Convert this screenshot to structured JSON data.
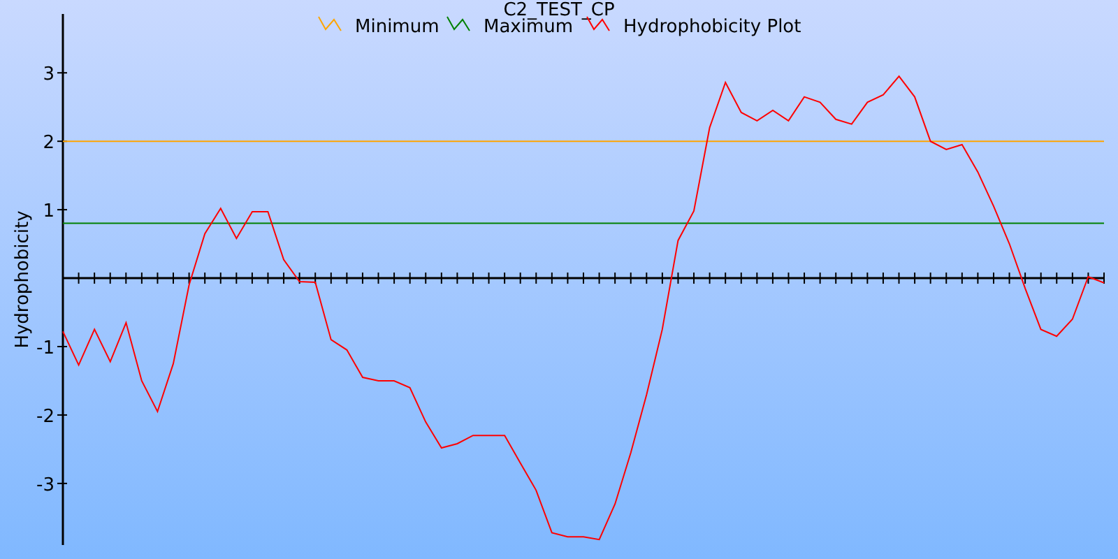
{
  "chart_data": {
    "type": "line",
    "title": "C2_TEST_CP",
    "ylabel": "Hydrophobicity",
    "legend": "top",
    "series": [
      {
        "name": "Minimum",
        "color": "#ffa500",
        "values": [
          2,
          2,
          2,
          2,
          2,
          2,
          2,
          2,
          2,
          2,
          2,
          2,
          2,
          2,
          2,
          2,
          2,
          2,
          2,
          2,
          2,
          2,
          2,
          2,
          2,
          2,
          2,
          2,
          2,
          2,
          2,
          2,
          2,
          2,
          2,
          2,
          2,
          2,
          2,
          2,
          2,
          2,
          2,
          2,
          2,
          2,
          2,
          2,
          2,
          2,
          2,
          2,
          2,
          2,
          2,
          2,
          2,
          2,
          2,
          2,
          2,
          2,
          2,
          2,
          2,
          2,
          2
        ]
      },
      {
        "name": "Maximum",
        "color": "#008000",
        "values": [
          0.8,
          0.8,
          0.8,
          0.8,
          0.8,
          0.8,
          0.8,
          0.8,
          0.8,
          0.8,
          0.8,
          0.8,
          0.8,
          0.8,
          0.8,
          0.8,
          0.8,
          0.8,
          0.8,
          0.8,
          0.8,
          0.8,
          0.8,
          0.8,
          0.8,
          0.8,
          0.8,
          0.8,
          0.8,
          0.8,
          0.8,
          0.8,
          0.8,
          0.8,
          0.8,
          0.8,
          0.8,
          0.8,
          0.8,
          0.8,
          0.8,
          0.8,
          0.8,
          0.8,
          0.8,
          0.8,
          0.8,
          0.8,
          0.8,
          0.8,
          0.8,
          0.8,
          0.8,
          0.8,
          0.8,
          0.8,
          0.8,
          0.8,
          0.8,
          0.8,
          0.8,
          0.8,
          0.8,
          0.8,
          0.8,
          0.8,
          0.8
        ]
      },
      {
        "name": "Hydrophobicity Plot",
        "color": "#ff0000",
        "values": [
          -0.78,
          -1.27,
          -0.75,
          -1.22,
          -0.65,
          -1.5,
          -1.95,
          -1.25,
          -0.1,
          0.65,
          1.02,
          0.58,
          0.97,
          0.97,
          0.27,
          -0.05,
          -0.06,
          -0.9,
          -1.05,
          -1.45,
          -1.5,
          -1.5,
          -1.6,
          -2.1,
          -2.48,
          -2.42,
          -2.3,
          -2.3,
          -2.3,
          -2.7,
          -3.1,
          -3.72,
          -3.78,
          -3.78,
          -3.82,
          -3.3,
          -2.55,
          -1.7,
          -0.75,
          0.55,
          0.98,
          2.2,
          2.86,
          2.42,
          2.3,
          2.45,
          2.3,
          2.65,
          2.57,
          2.32,
          2.25,
          2.57,
          2.68,
          2.95,
          2.65,
          2.0,
          1.88,
          1.95,
          1.55,
          1.05,
          0.5,
          -0.15,
          -0.75,
          -0.85,
          -0.6,
          0.02,
          -0.07
        ]
      }
    ],
    "ylim": [
      -3.9,
      3.86
    ],
    "yticks": [
      -3,
      -2,
      -1,
      1,
      2,
      3
    ]
  }
}
